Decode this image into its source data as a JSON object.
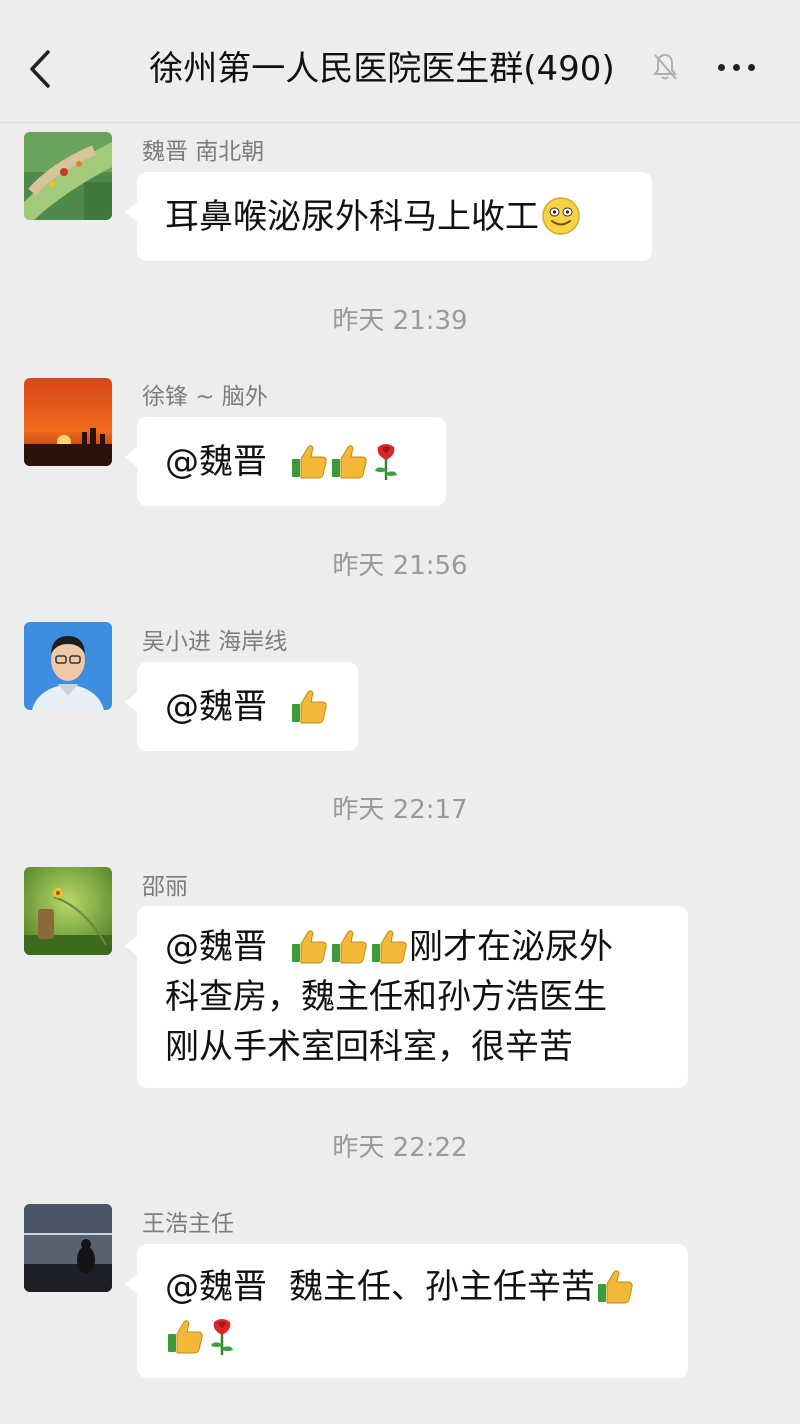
{
  "header": {
    "title": "徐州第一人民医院医生群(490)"
  },
  "messages": [
    {
      "sender": "魏晋  南北朝",
      "lines": [
        "耳鼻喉泌尿外科马上收工"
      ]
    },
    {
      "sender": "徐锋 ~ 脑外",
      "lines": [
        "@魏晋"
      ]
    },
    {
      "sender": "吴小进 海岸线",
      "lines": [
        "@魏晋"
      ]
    },
    {
      "sender": "邵丽",
      "lines": [
        "@魏晋",
        "刚才在泌尿外",
        "科查房，魏主任和孙方浩医生",
        "刚从手术室回科室，很辛苦"
      ]
    },
    {
      "sender": "王浩主任",
      "lines": [
        "@魏晋",
        "魏主任、孙主任辛苦"
      ]
    }
  ],
  "timestamps": [
    "昨天 21:39",
    "昨天 21:56",
    "昨天 22:17",
    "昨天 22:22"
  ],
  "icons": {
    "back": "chevron-left-icon",
    "mute": "bell-muted-icon",
    "more": "ellipsis-icon",
    "thumbs_up": "thumbs-up-emoji",
    "rose": "rose-emoji",
    "smile": "smile-emoji"
  },
  "colors": {
    "background": "#ededed",
    "bubble": "#ffffff",
    "meta_text": "#9a9a9a"
  }
}
